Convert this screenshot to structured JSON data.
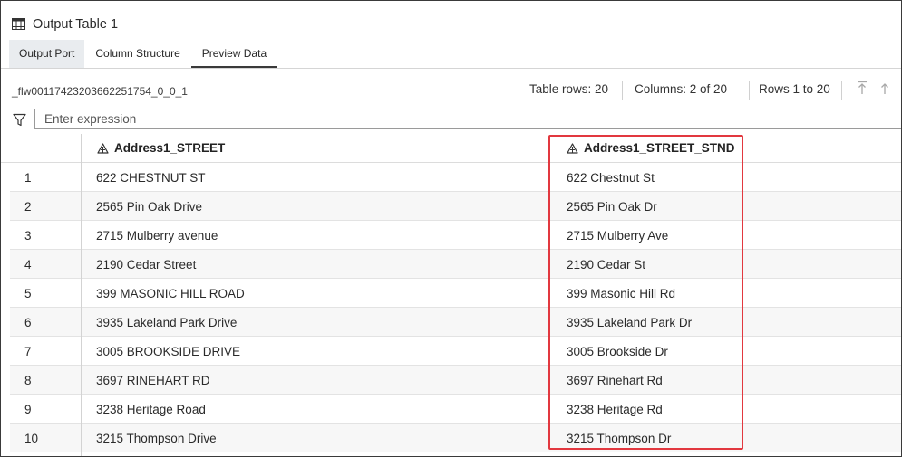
{
  "window": {
    "title": "Output Table 1",
    "icon": "table-grid-icon"
  },
  "tabs": [
    {
      "label": "Output Port"
    },
    {
      "label": "Column Structure"
    },
    {
      "label": "Preview Data"
    }
  ],
  "active_tab": "Preview Data",
  "info": {
    "flow_id": "_flw00117423203662251754_0_0_1",
    "table_rows": "Table rows: 20",
    "columns": "Columns: 2 of 20",
    "rows_range": "Rows 1 to 20"
  },
  "filter": {
    "placeholder": "Enter expression",
    "icon": "filter-funnel-icon"
  },
  "columns": [
    {
      "name": "Address1_STREET",
      "icon": "character-type-icon"
    },
    {
      "name": "Address1_STREET_STND",
      "icon": "character-type-icon"
    }
  ],
  "rows": [
    {
      "num": "1",
      "street": "622 CHESTNUT ST",
      "stnd": "622 Chestnut St"
    },
    {
      "num": "2",
      "street": "2565 Pin Oak Drive",
      "stnd": "2565 Pin Oak Dr"
    },
    {
      "num": "3",
      "street": "2715 Mulberry avenue",
      "stnd": "2715 Mulberry Ave"
    },
    {
      "num": "4",
      "street": "2190 Cedar Street",
      "stnd": "2190 Cedar St"
    },
    {
      "num": "5",
      "street": "399 MASONIC HILL ROAD",
      "stnd": "399 Masonic Hill Rd"
    },
    {
      "num": "6",
      "street": "3935 Lakeland Park Drive",
      "stnd": "3935 Lakeland Park Dr"
    },
    {
      "num": "7",
      "street": "3005 BROOKSIDE DRIVE",
      "stnd": "3005 Brookside Dr"
    },
    {
      "num": "8",
      "street": "3697 RINEHART RD",
      "stnd": "3697 Rinehart Rd"
    },
    {
      "num": "9",
      "street": "3238 Heritage Road",
      "stnd": "3238 Heritage Rd"
    },
    {
      "num": "10",
      "street": "3215 Thompson Drive",
      "stnd": "3215 Thompson Dr"
    }
  ],
  "colors": {
    "highlight": "#e2383f",
    "active_tab_underline": "#3a3a3a"
  }
}
